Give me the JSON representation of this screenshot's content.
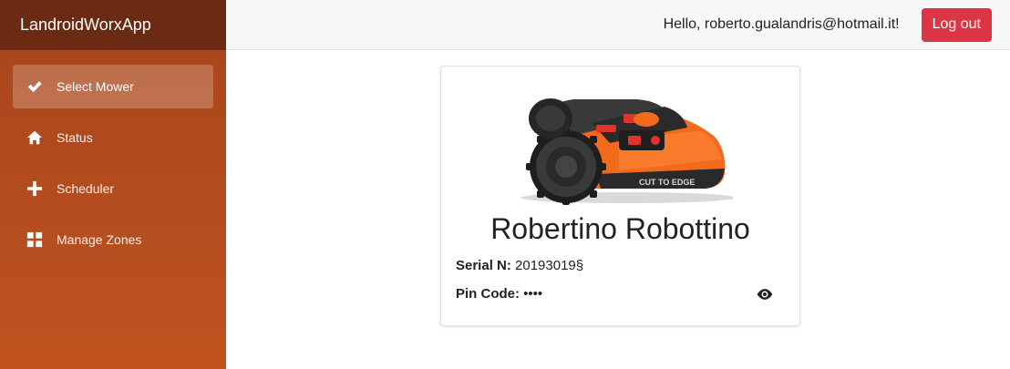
{
  "app": {
    "title": "LandroidWorxApp"
  },
  "sidebar": {
    "items": [
      {
        "label": "Select Mower",
        "icon": "check-icon",
        "active": true
      },
      {
        "label": "Status",
        "icon": "home-icon",
        "active": false
      },
      {
        "label": "Scheduler",
        "icon": "plus-icon",
        "active": false
      },
      {
        "label": "Manage Zones",
        "icon": "grid-icon",
        "active": false
      }
    ]
  },
  "header": {
    "greeting": "Hello, roberto.gualandris@hotmail.it!",
    "logout_label": "Log out"
  },
  "mower": {
    "name": "Robertino Robottino",
    "serial_label": "Serial N:",
    "serial_value": "20193019§",
    "pin_label": "Pin Code:",
    "pin_value": "••••",
    "reveal_icon": "eye-icon",
    "image_text": "CUT TO EDGE"
  },
  "colors": {
    "sidebar_top": "#6b2a12",
    "sidebar_bg": "#b14b1f",
    "logout": "#dc3545",
    "mower_orange": "#f26a1b"
  }
}
